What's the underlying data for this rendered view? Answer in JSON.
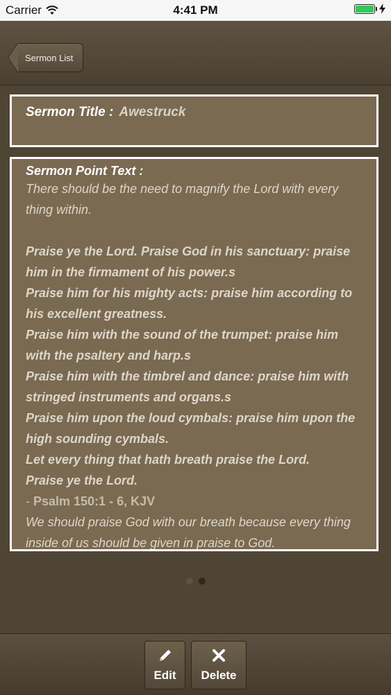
{
  "status_bar": {
    "carrier": "Carrier",
    "time": "4:41 PM",
    "icons": [
      "wifi-icon",
      "battery-icon",
      "charging-bolt-icon"
    ],
    "battery_color": "#34c759"
  },
  "nav": {
    "back_label": "Sermon List"
  },
  "sermon": {
    "title_label": "Sermon Title :",
    "title_value": "Awestruck",
    "point_label": "Sermon Point Text :",
    "intro": "There should be the need to magnify the Lord with every thing within.",
    "verses": [
      "Praise ye the Lord. Praise God in his sanctuary: praise him in the firmament of his power.s",
      "Praise him for his mighty acts: praise him according to his excellent greatness.",
      "Praise him with the sound of the trumpet: praise him with the psaltery and harp.s",
      "Praise him with the timbrel and dance: praise him with stringed instruments and organs.s",
      "Praise him upon the loud cymbals: praise him upon the high sounding cymbals.",
      "Let every thing that hath breath praise the Lord.",
      "Praise ye the Lord."
    ],
    "citation_dash": "- ",
    "citation": "Psalm 150:1 - 6, KJV",
    "outro": "We should praise God with our breath because every thing inside of us should be given in praise to God."
  },
  "pagination": {
    "total": 2,
    "active": 2
  },
  "toolbar": {
    "edit_label": "Edit",
    "delete_label": "Delete",
    "icons": [
      "pencil-icon",
      "close-icon"
    ]
  },
  "colors": {
    "background": "#4f4535",
    "panel": "#7a6a52",
    "panel_border": "#ffffff"
  }
}
